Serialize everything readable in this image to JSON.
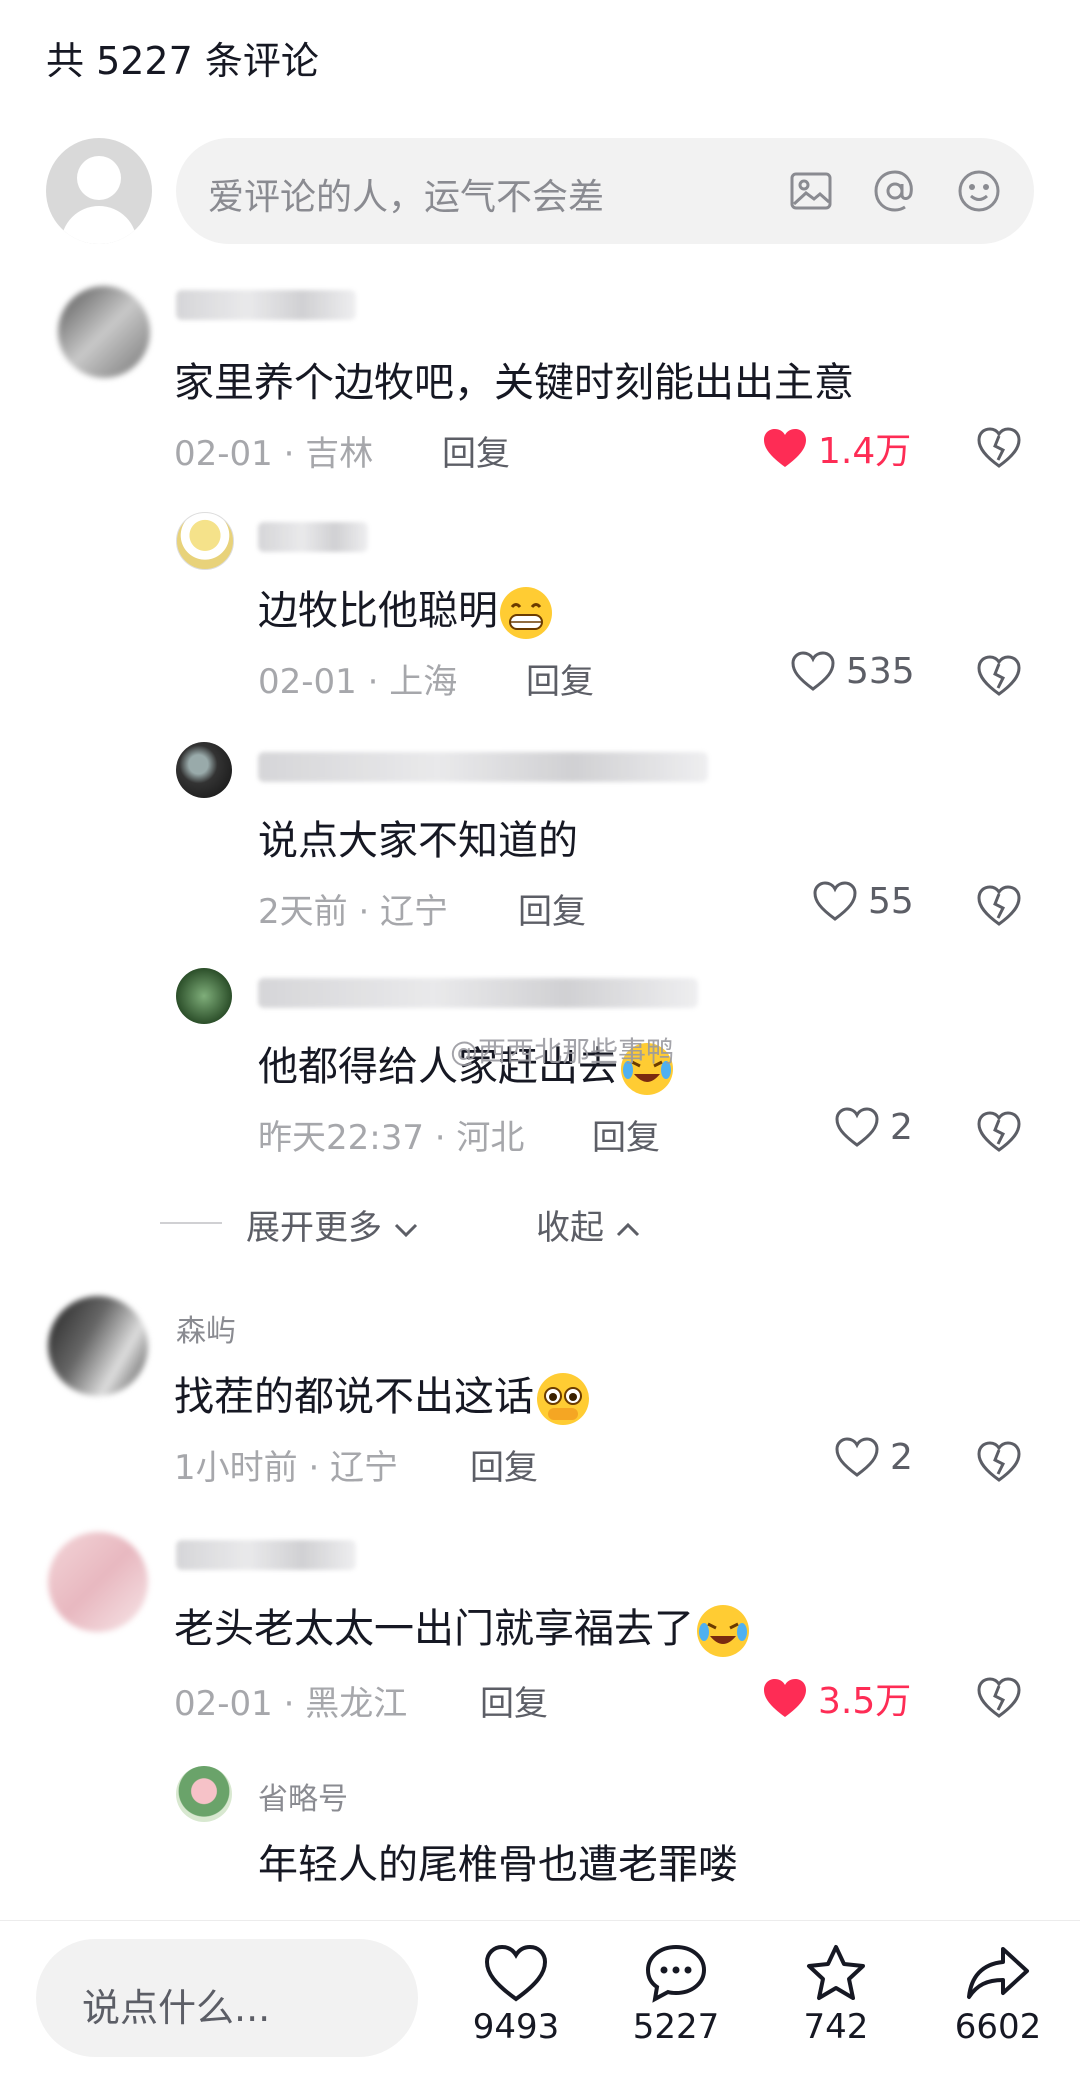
{
  "header": {
    "title": "共 5227 条评论"
  },
  "input": {
    "placeholder": "爱评论的人，运气不会差"
  },
  "comments": [
    {
      "text": "家里养个边牧吧，关键时刻能出出主意",
      "time": "02-01 · 吉林",
      "reply": "回复",
      "likes": "1.4万",
      "liked": true
    },
    {
      "text": "边牧比他聪明",
      "time": "02-01 · 上海",
      "reply": "回复",
      "likes": "535",
      "liked": false
    },
    {
      "text": "说点大家不知道的",
      "time": "2天前 · 辽宁",
      "reply": "回复",
      "likes": "55",
      "liked": false
    },
    {
      "text": "他都得给人家赶出去",
      "time": "昨天22:37 · 河北",
      "reply": "回复",
      "likes": "2",
      "liked": false
    },
    {
      "name": "森屿",
      "text": "找茬的都说不出这话",
      "time": "1小时前 · 辽宁",
      "reply": "回复",
      "likes": "2",
      "liked": false
    },
    {
      "text": "老头老太太一出门就享福去了",
      "time": "02-01 · 黑龙江",
      "reply": "回复",
      "likes": "3.5万",
      "liked": true
    },
    {
      "name": "省略号",
      "text": "年轻人的尾椎骨也遭老罪喽"
    }
  ],
  "thread": {
    "expand": "展开更多",
    "collapse": "收起"
  },
  "watermark": "@西西北那些事鸭",
  "bottom": {
    "say_placeholder": "说点什么...",
    "like_count": "9493",
    "comment_count": "5227",
    "fav_count": "742",
    "share_count": "6602"
  },
  "colors": {
    "accent": "#fe2c55",
    "muted": "#a6a7ab"
  }
}
